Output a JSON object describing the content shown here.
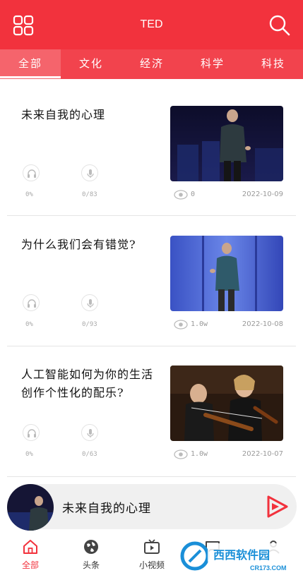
{
  "header": {
    "title": "TED",
    "menu_icon": "grid-icon",
    "search_icon": "search-icon",
    "accent_color": "#f2323d"
  },
  "tabs": [
    {
      "label": "全部",
      "active": true
    },
    {
      "label": "文化",
      "active": false
    },
    {
      "label": "经济",
      "active": false
    },
    {
      "label": "科学",
      "active": false
    },
    {
      "label": "科技",
      "active": false
    }
  ],
  "articles": [
    {
      "title": "未来自我的心理",
      "listen_progress": "0%",
      "record_count": "0/83",
      "views": "0",
      "date": "2022-10-09"
    },
    {
      "title": "为什么我们会有错觉?",
      "listen_progress": "0%",
      "record_count": "0/93",
      "views": "1.0w",
      "date": "2022-10-08"
    },
    {
      "title": "人工智能如何为你的生活创作个性化的配乐?",
      "listen_progress": "0%",
      "record_count": "0/63",
      "views": "1.0w",
      "date": "2022-10-07"
    }
  ],
  "player": {
    "title": "未来自我的心理",
    "play_icon": "play-icon"
  },
  "bottom_nav": [
    {
      "label": "全部",
      "icon": "home-icon",
      "active": true
    },
    {
      "label": "头条",
      "icon": "globe-icon",
      "active": false
    },
    {
      "label": "小视频",
      "icon": "tv-icon",
      "active": false
    },
    {
      "label": "",
      "icon": "chat-icon",
      "active": false
    },
    {
      "label": "",
      "icon": "user-icon",
      "active": false
    }
  ],
  "watermark": {
    "brand": "西西软件园",
    "url": "CR173.COM"
  }
}
